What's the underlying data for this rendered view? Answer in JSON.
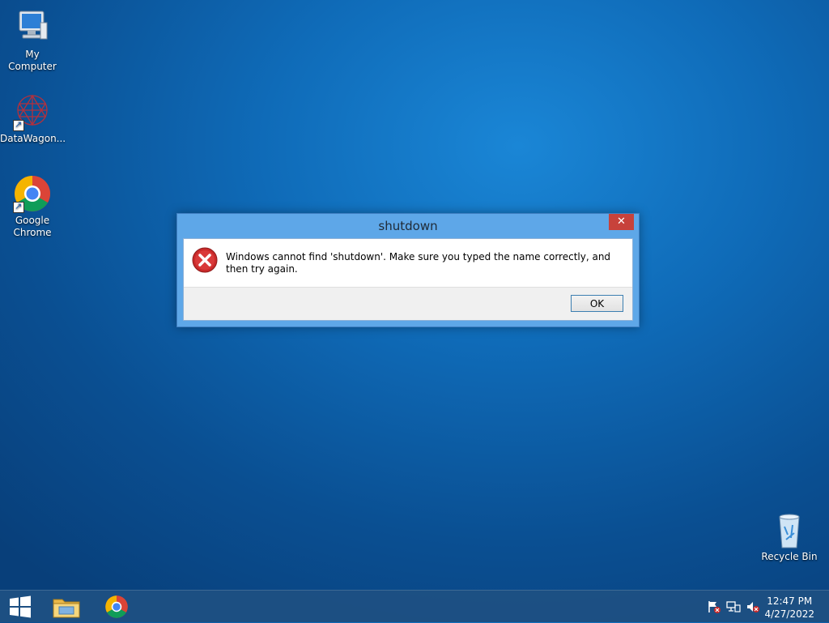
{
  "desktop": {
    "icons": [
      {
        "label": "My Computer"
      },
      {
        "label": "DataWagon..."
      },
      {
        "label": "Google Chrome"
      },
      {
        "label": "Recycle Bin"
      }
    ]
  },
  "dialog": {
    "title": "shutdown",
    "close_glyph": "✕",
    "message": "Windows cannot find 'shutdown'. Make sure you typed the name correctly, and then try again.",
    "ok_label": "OK",
    "icon": "error-icon"
  },
  "taskbar": {
    "start_icon": "windows-logo-icon",
    "pinned": [
      "file-explorer-icon",
      "chrome-icon"
    ],
    "tray": [
      "action-center-flag-icon",
      "network-icon",
      "volume-muted-icon"
    ],
    "time": "12:47 PM",
    "date": "4/27/2022"
  },
  "colors": {
    "close_button": "#c7423b",
    "dialog_frame": "#5ea7e8",
    "desktop_bg": "#0f6bb8"
  }
}
